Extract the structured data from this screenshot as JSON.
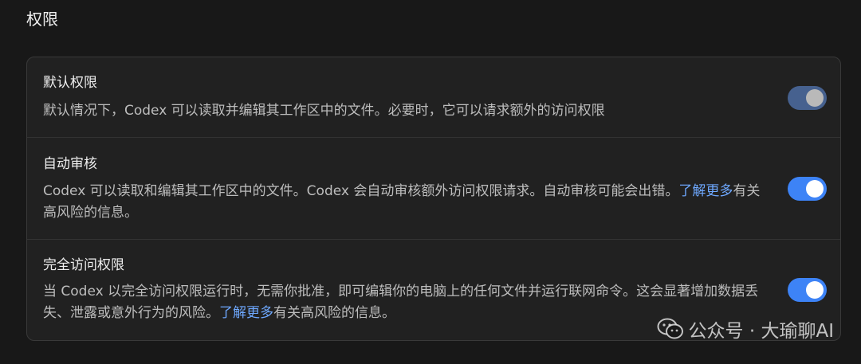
{
  "section": {
    "title": "权限"
  },
  "permissions": [
    {
      "title": "默认权限",
      "description": "默认情况下，Codex 可以读取并编辑其工作区中的文件。必要时，它可以请求额外的访问权限",
      "enabled": true,
      "state": "dimmed"
    },
    {
      "title": "自动审核",
      "description_before": "Codex 可以读取和编辑其工作区中的文件。Codex 会自动审核额外访问权限请求。自动审核可能会出错。",
      "link_text": "了解更多",
      "description_after": "有关高风险的信息。",
      "enabled": true,
      "state": "on"
    },
    {
      "title": "完全访问权限",
      "description_before": "当 Codex 以完全访问权限运行时，无需你批准，即可编辑你的电脑上的任何文件并运行联网命令。这会显著增加数据丢失、泄露或意外行为的风险。",
      "link_text": "了解更多",
      "description_after": "有关高风险的信息。",
      "enabled": true,
      "state": "on"
    }
  ],
  "watermark": {
    "text": "公众号 · 大瑜聊AI",
    "icon": "wechat-icon"
  },
  "colors": {
    "background": "#181818",
    "card": "#212121",
    "accent": "#3d83f6",
    "link": "#6ea8ff"
  }
}
